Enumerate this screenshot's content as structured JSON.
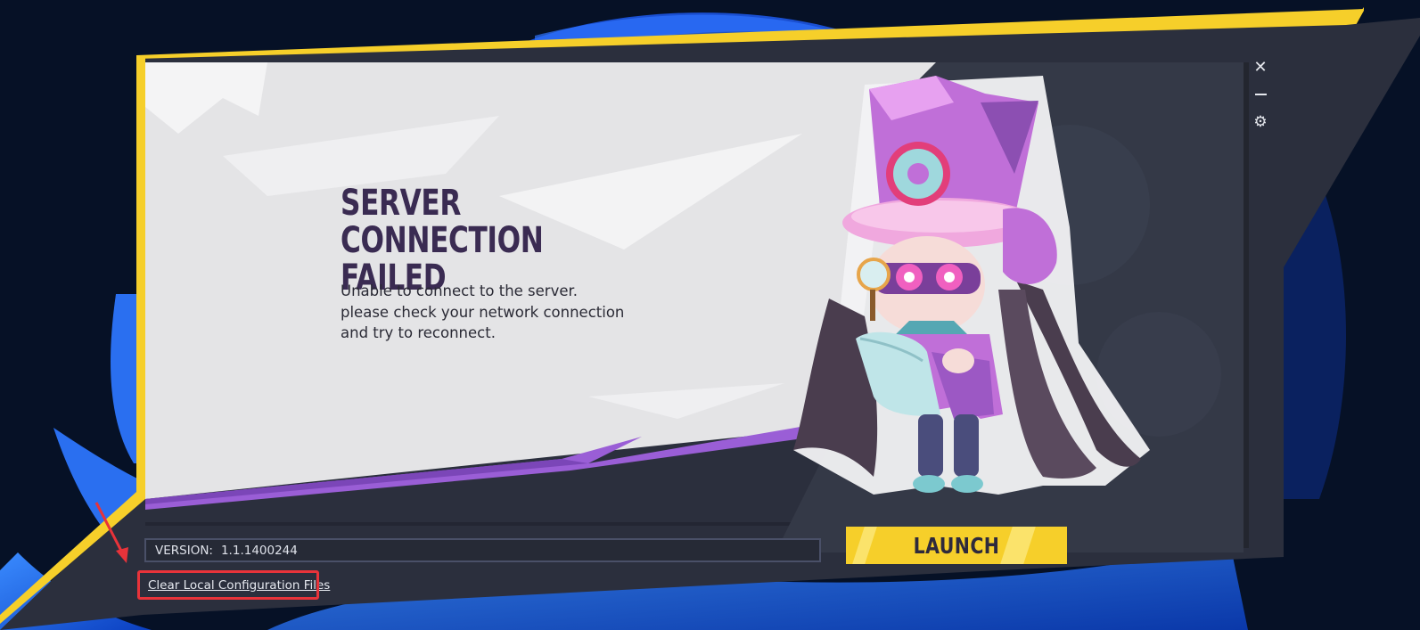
{
  "dialog": {
    "title_line1": "SERVER CONNECTION",
    "title_line2": "FAILED",
    "message_line1": "Unable to connect to the server.",
    "message_line2": "please check your network connection",
    "message_line3": "and try to reconnect."
  },
  "window_controls": {
    "close": "✕",
    "settings": "⚙"
  },
  "footer": {
    "version_label": "VERSION:",
    "version_value": "1.1.1400244",
    "launch_label": "LAUNCH",
    "clear_config_label": "Clear Local Configuration Files"
  },
  "colors": {
    "accent_yellow": "#f6cf2a",
    "panel_dark": "#2b2f3d",
    "content_bg": "#e4e4e6",
    "title_text": "#3a2b52",
    "purple_accent": "#9a5ed6",
    "annotation_red": "#e8333a"
  },
  "icons": [
    "close-icon",
    "minimize-icon",
    "settings-icon",
    "character-illustration",
    "annotation-arrow"
  ]
}
